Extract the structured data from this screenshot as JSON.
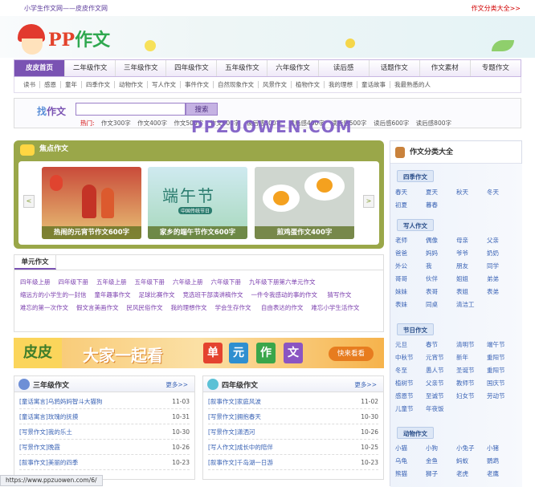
{
  "topbar": {
    "site": "小学生作文网——皮皮作文网",
    "right_link": "作文分类大全>>"
  },
  "logo": {
    "p": "PP",
    "text": "作文"
  },
  "nav": [
    "皮皮首页",
    "二年级作文",
    "三年级作文",
    "四年级作文",
    "五年级作文",
    "六年级作文",
    "读后感",
    "话题作文",
    "作文素材",
    "专题作文"
  ],
  "subnav": [
    "读书",
    "感恩",
    "童年",
    "四季作文",
    "动物作文",
    "写人作文",
    "事件作文",
    "自然现象作文",
    "风景作文",
    "植物作文",
    "我的理想",
    "童话故事",
    "我最熟悉的人"
  ],
  "search": {
    "find_label_1": "找",
    "find_label_2": "作文",
    "placeholder": "",
    "button": "搜索",
    "hot_label": "热门:",
    "hot": [
      "作文300字",
      "作文400字",
      "作文500字",
      "作文600字",
      "读后感300字",
      "读后感400字",
      "读后感500字",
      "读后感600字",
      "读后感800字"
    ]
  },
  "watermark": "PPZUOWEN.COM",
  "focus": {
    "title": "焦点作文",
    "prev": "<",
    "next": ">",
    "cards": [
      "热闹的元宵节作文600字",
      "家乡的端午节作文600字",
      "煎鸡蛋作文400字"
    ],
    "card2_big": "端午节",
    "card2_small": "中国传统节日"
  },
  "unit": {
    "tab": "单元作文",
    "links": [
      "四年级上册",
      "四年级下册",
      "五年级上册",
      "五年级下册",
      "六年级上册",
      "六年级下册",
      "九年级下册第六单元作文",
      "缩远方的小学生的一封信",
      "童年趣事作文",
      "足球比赛作文",
      "竞选班干部演讲稿作文",
      "一件令我感动的事的作文",
      "猜写作文",
      "难忘的第一次作文",
      "假文言美画作文",
      "民风民俗作文",
      "我的理想作文",
      "学会生存作文",
      "自由表达的作文",
      "难忘小学生活作文"
    ]
  },
  "ad": {
    "pipi": "皮皮",
    "slogan": "大家一起看",
    "blocks": [
      "单",
      "元",
      "作",
      "文"
    ],
    "cta": "快来看看"
  },
  "col_left": {
    "title": "三年级作文",
    "more": "更多>>",
    "items": [
      {
        "t": "[童话寓言]乌鸦妈妈智斗大猫狗",
        "d": "11-03"
      },
      {
        "t": "[童话寓言]玫瑰的抚摸",
        "d": "10-31"
      },
      {
        "t": "[写景作文]我的乐土",
        "d": "10-30"
      },
      {
        "t": "[写景作文]晚霞",
        "d": "10-26"
      },
      {
        "t": "[叙事作文]美丽的四季",
        "d": "10-23"
      }
    ]
  },
  "col_right": {
    "title": "四年级作文",
    "more": "更多>>",
    "items": [
      {
        "t": "[叙事作文]家庭风波",
        "d": "11-02"
      },
      {
        "t": "[写景作文]拥抱春天",
        "d": "10-30"
      },
      {
        "t": "[写景作文]潇洒河",
        "d": "10-26"
      },
      {
        "t": "[写人作文]成长中的陪伴",
        "d": "10-25"
      },
      {
        "t": "[叙事作文]千岛湖一日游",
        "d": "10-23"
      }
    ]
  },
  "sidebar": {
    "title": "作文分类大全",
    "groups": [
      {
        "name": "四季作文",
        "items": [
          "春天",
          "夏天",
          "秋天",
          "冬天",
          "初夏",
          "暮春"
        ]
      },
      {
        "name": "写人作文",
        "items": [
          "老师",
          "偶像",
          "母亲",
          "父亲",
          "爸爸",
          "妈妈",
          "爷爷",
          "奶奶",
          "外公",
          "我",
          "朋友",
          "同学",
          "哥哥",
          "伙伴",
          "姐姐",
          "弟弟",
          "妹妹",
          "表哥",
          "表姐",
          "表弟",
          "表妹",
          "同桌",
          "清洁工"
        ]
      },
      {
        "name": "节日作文",
        "items": [
          "元旦",
          "春节",
          "清明节",
          "端午节",
          "中秋节",
          "元宵节",
          "新年",
          "重阳节",
          "冬至",
          "愚人节",
          "圣诞节",
          "重阳节",
          "植树节",
          "父亲节",
          "教师节",
          "国庆节",
          "感恩节",
          "至诚节",
          "妇女节",
          "劳动节",
          "儿童节",
          "年夜饭"
        ]
      },
      {
        "name": "动物作文",
        "items": [
          "小猫",
          "小狗",
          "小兔子",
          "小猪",
          "乌龟",
          "金鱼",
          "蚂蚁",
          "鹦鹉",
          "熊猫",
          "狮子",
          "老虎",
          "老鹰"
        ]
      }
    ]
  },
  "status": "https://www.ppzuowen.com/6/"
}
